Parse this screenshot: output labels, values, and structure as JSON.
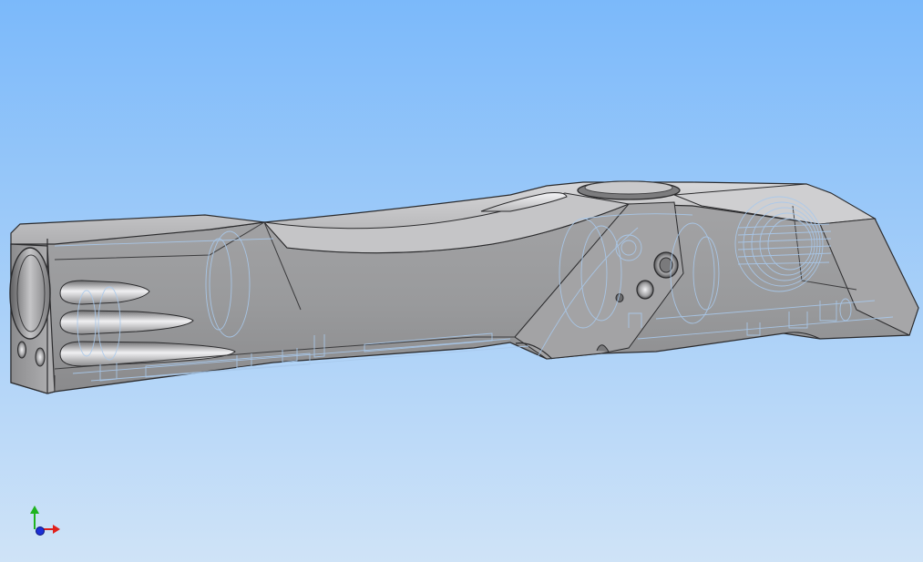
{
  "viewport": {
    "background": {
      "top_color": "#7bb9fa",
      "bottom_color": "#cfe3f7"
    },
    "display_mode": "shaded-with-hidden-edges",
    "model": {
      "kind": "machined-housing-part",
      "body_color": "#9c9c9e",
      "highlight_color": "#e6e6e8",
      "shadow_color": "#6e6e70",
      "edge_color": "#2b2b2d",
      "hidden_line_color": "#a9c9ec"
    },
    "triad": {
      "x_axis_color": "#e0201c",
      "y_axis_color": "#1fb31f",
      "z_axis_color": "#1c2fd6"
    }
  }
}
